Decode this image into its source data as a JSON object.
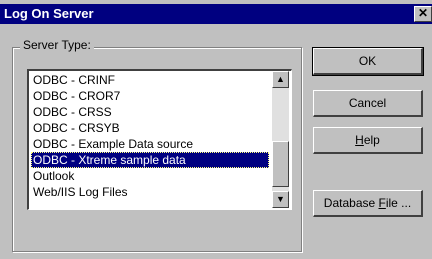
{
  "window": {
    "title": "Log On Server",
    "close_glyph": "✕"
  },
  "group": {
    "label": "Server Type:"
  },
  "list": {
    "items": [
      "ODBC - CRINF",
      "ODBC - CROR7",
      "ODBC - CRSS",
      "ODBC - CRSYB",
      "ODBC - Example Data source",
      "ODBC - Xtreme sample data",
      "Outlook",
      "Web/IIS Log Files"
    ],
    "selected": "ODBC - Xtreme sample data"
  },
  "buttons": {
    "ok": "OK",
    "cancel": "Cancel",
    "help_accel": "H",
    "help_rest": "elp",
    "dbfile_pre": "Database ",
    "dbfile_accel": "F",
    "dbfile_post": "ile ..."
  },
  "colors": {
    "titlebar": "#000080",
    "face": "#c0c0c0",
    "selection": "#000080"
  }
}
